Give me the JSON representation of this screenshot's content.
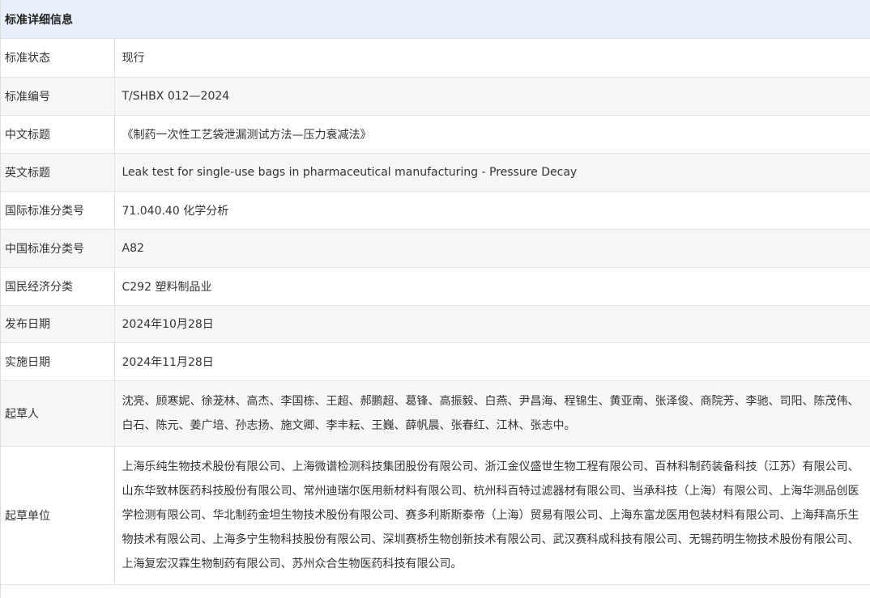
{
  "header": {
    "title": "标准详细信息"
  },
  "rows": [
    {
      "label": "标准状态",
      "value": "现行"
    },
    {
      "label": "标准编号",
      "value": "T/SHBX 012—2024"
    },
    {
      "label": "中文标题",
      "value": "《制药一次性工艺袋泄漏测试方法—压力衰减法》"
    },
    {
      "label": "英文标题",
      "value": "Leak test for single-use bags in pharmaceutical manufacturing - Pressure Decay"
    },
    {
      "label": "国际标准分类号",
      "value": "71.040.40 化学分析"
    },
    {
      "label": "中国标准分类号",
      "value": "A82"
    },
    {
      "label": "国民经济分类",
      "value": "C292 塑料制品业"
    },
    {
      "label": "发布日期",
      "value": "2024年10月28日"
    },
    {
      "label": "实施日期",
      "value": "2024年11月28日"
    },
    {
      "label": "起草人",
      "value": "沈亮、顾寒妮、徐茏林、高杰、李国栋、王超、郝鹏超、葛锋、高振毅、白燕、尹昌海、程锦生、黄亚南、张泽俊、商院芳、李驰、司阳、陈茂伟、白石、陈元、姜广培、孙志扬、施文卿、李丰耘、王巍、薛帆晨、张春红、江林、张志中。"
    },
    {
      "label": "起草单位",
      "value": "上海乐纯生物技术股份有限公司、上海微谱检测科技集团股份有限公司、浙江金仪盛世生物工程有限公司、百林科制药装备科技（江苏）有限公司、山东华致林医药科技股份有限公司、常州迪瑞尔医用新材料有限公司、杭州科百特过滤器材有限公司、当承科技（上海）有限公司、上海华测品创医学检测有限公司、华北制药金坦生物技术股份有限公司、赛多利斯斯泰帝（上海）贸易有限公司、上海东富龙医用包装材料有限公司、上海拜高乐生物技术有限公司、上海多宁生物科技股份有限公司、深圳赛桥生物创新技术有限公司、武汉赛科成科技有限公司、无锡药明生物技术股份有限公司、上海复宏汉霖生物制药有限公司、苏州众合生物医药科技有限公司。"
    }
  ]
}
